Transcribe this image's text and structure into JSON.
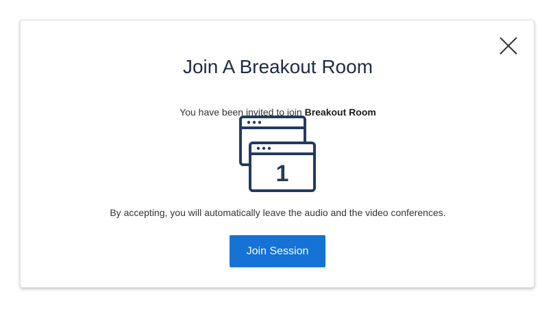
{
  "dialog": {
    "title": "Join A Breakout Room",
    "invite_prefix": "You have been invited to join ",
    "room_name": "Breakout Room",
    "room_number": "1",
    "notice": "By accepting, you will automatically leave the audio and the video conferences.",
    "join_button": "Join Session",
    "close_icon": "close-icon",
    "illustration_icon": "breakout-windows-icon"
  },
  "colors": {
    "accent": "#1672d4",
    "icon": "#243a5e",
    "title": "#1f2a44"
  }
}
